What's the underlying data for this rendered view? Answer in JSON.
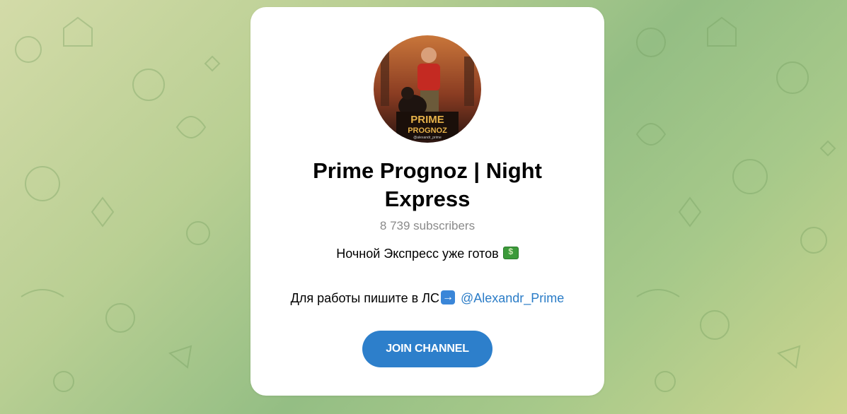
{
  "channel": {
    "name": "Prime Prognoz | Night Express",
    "subscribers": "8 739 subscribers",
    "description_line1": "Ночной Экспресс уже готов",
    "description_line2_prefix": "Для работы пишите в ЛС",
    "contact_link": "@Alexandr_Prime",
    "avatar_text_line1": "PRIME",
    "avatar_text_line2": "PROGNOZ",
    "avatar_text_line3": "@alexandr_prime"
  },
  "join_button": {
    "label": "JOIN CHANNEL"
  },
  "icons": {
    "money": "money-bill-icon",
    "arrow": "right-arrow-icon"
  },
  "colors": {
    "accent": "#2d7fcb",
    "link": "#2a7cc7",
    "subtitle": "#8a8a8a",
    "background_green": "#94be84"
  }
}
